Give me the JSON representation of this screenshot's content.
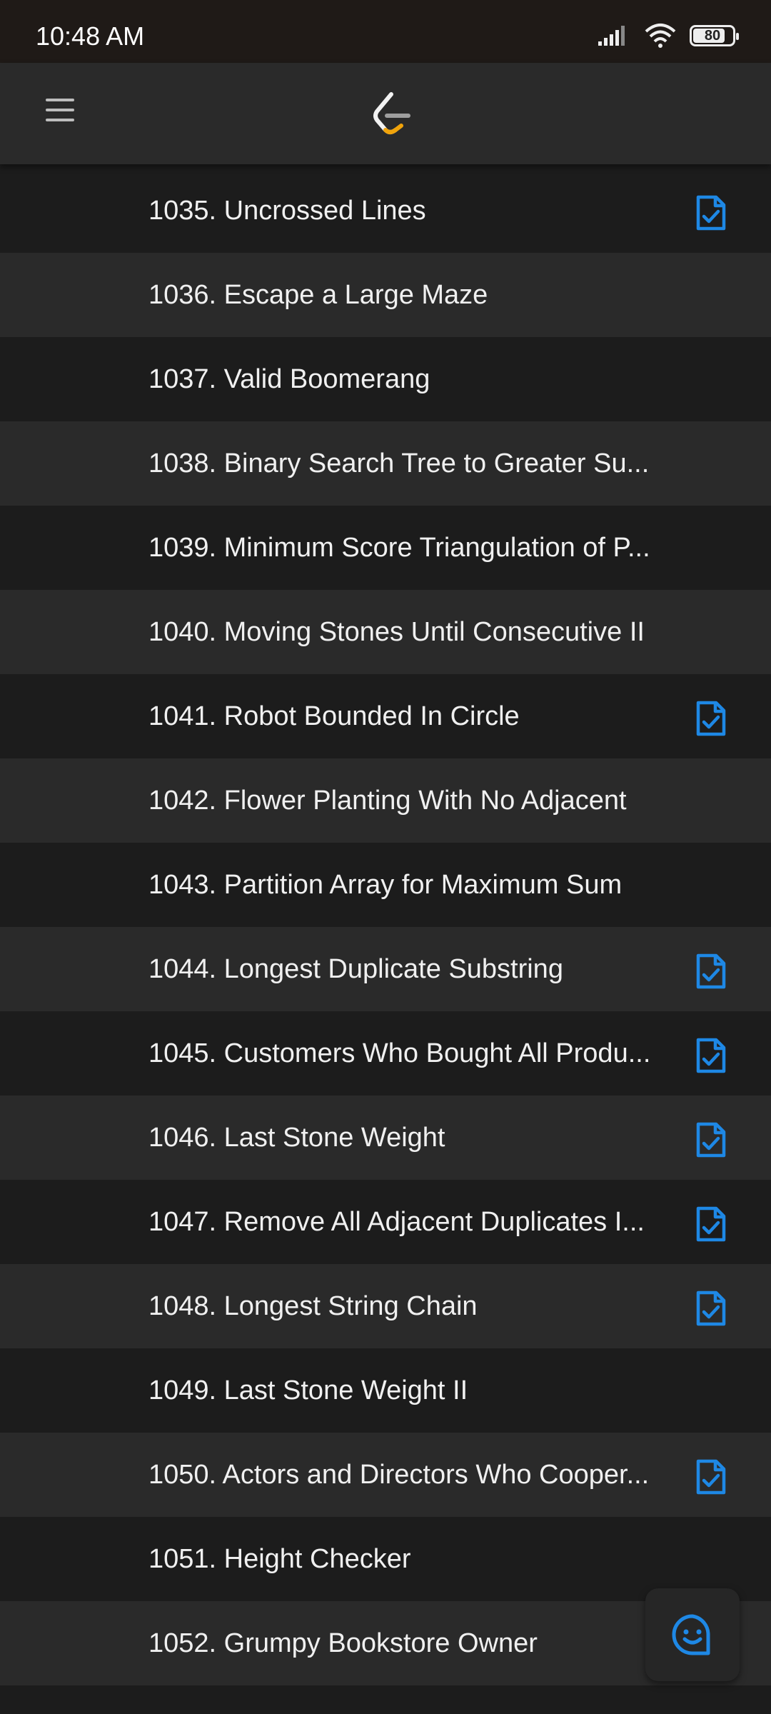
{
  "status_bar": {
    "time": "10:48 AM",
    "battery_level": "80"
  },
  "header": {
    "menu_icon": "hamburger-menu-icon",
    "logo_icon": "leetcode-logo-icon"
  },
  "colors": {
    "accent_blue": "#1e88e5",
    "row_dark": "#1c1c1c",
    "row_light": "#2a2a2a",
    "logo_orange": "#f0a30a"
  },
  "problems": [
    {
      "title": "1035. Uncrossed Lines",
      "has_solution": true
    },
    {
      "title": "1036. Escape a Large Maze",
      "has_solution": false
    },
    {
      "title": "1037. Valid Boomerang",
      "has_solution": false
    },
    {
      "title": "1038. Binary Search Tree to Greater Su...",
      "has_solution": false
    },
    {
      "title": "1039. Minimum Score Triangulation of P...",
      "has_solution": false
    },
    {
      "title": "1040. Moving Stones Until Consecutive II",
      "has_solution": false
    },
    {
      "title": "1041. Robot Bounded In Circle",
      "has_solution": true
    },
    {
      "title": "1042. Flower Planting With No Adjacent",
      "has_solution": false
    },
    {
      "title": "1043. Partition Array for Maximum Sum",
      "has_solution": false
    },
    {
      "title": "1044. Longest Duplicate Substring",
      "has_solution": true
    },
    {
      "title": "1045. Customers Who Bought All Produ...",
      "has_solution": true
    },
    {
      "title": "1046. Last Stone Weight",
      "has_solution": true
    },
    {
      "title": "1047. Remove All Adjacent Duplicates I...",
      "has_solution": true
    },
    {
      "title": "1048. Longest String Chain",
      "has_solution": true
    },
    {
      "title": "1049. Last Stone Weight II",
      "has_solution": false
    },
    {
      "title": "1050. Actors and Directors Who Cooper...",
      "has_solution": true
    },
    {
      "title": "1051. Height Checker",
      "has_solution": false
    },
    {
      "title": "1052. Grumpy Bookstore Owner",
      "has_solution": false
    }
  ],
  "fab": {
    "icon": "chat-smiley-icon"
  }
}
